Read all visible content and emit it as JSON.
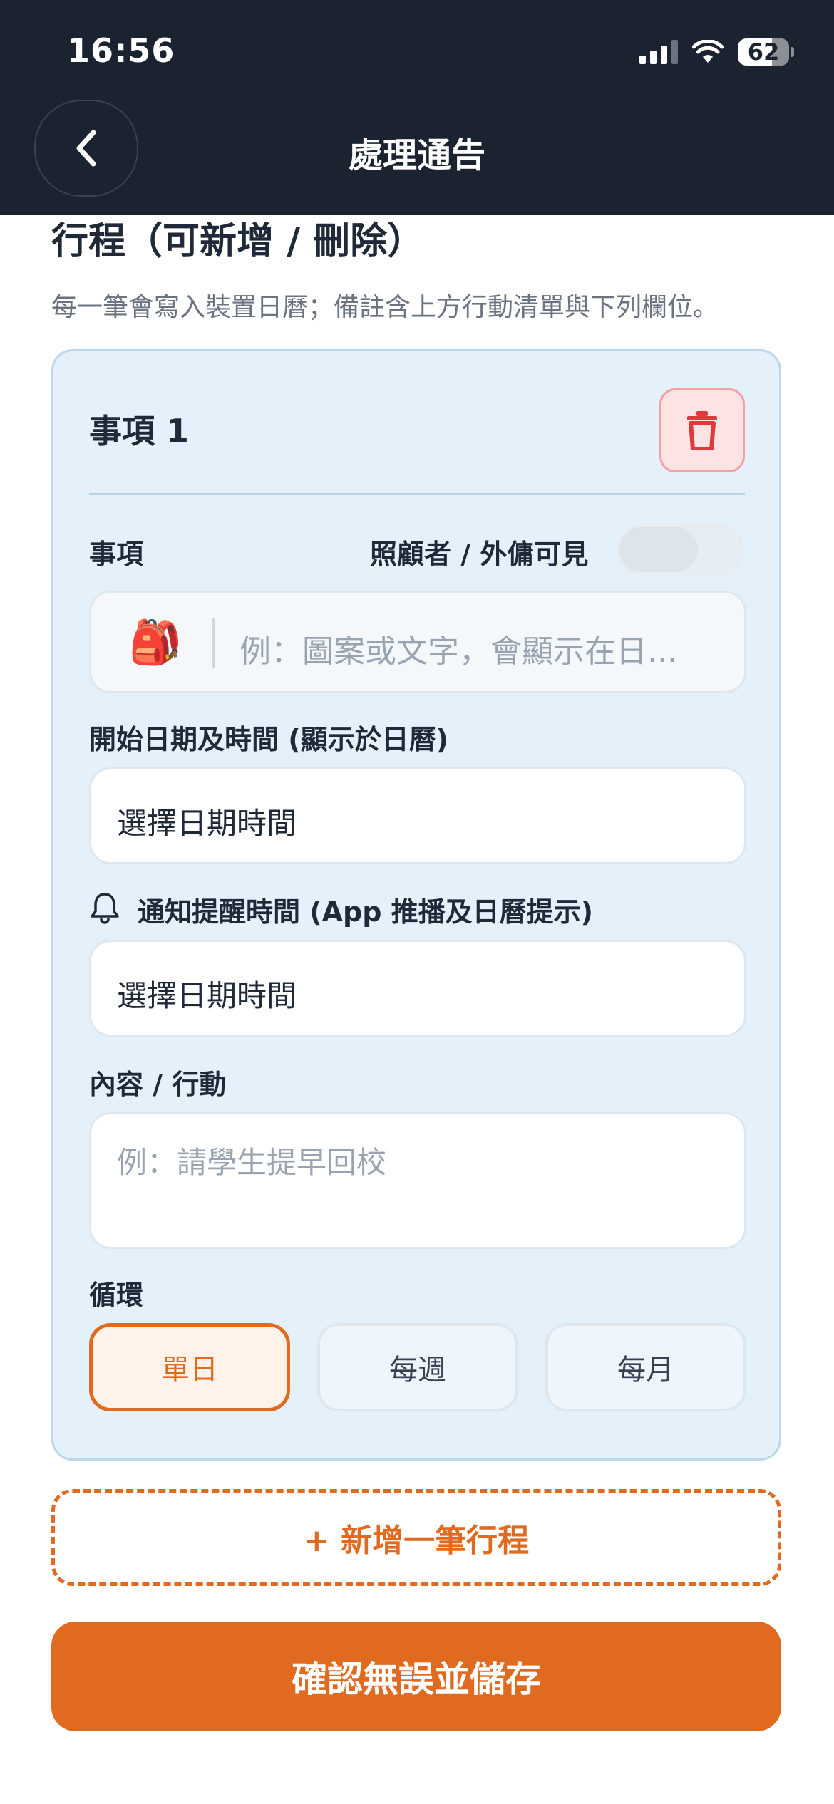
{
  "status_bar": {
    "time": "16:56",
    "battery": "62"
  },
  "header": {
    "title": "處理通告"
  },
  "section": {
    "title": "行程（可新增 / 刪除）",
    "subtitle": "每一筆會寫入裝置日曆；備註含上方行動清單與下列欄位。"
  },
  "item": {
    "title": "事項 1",
    "event_label": "事項",
    "visibility_label": "照顧者 / 外傭可見",
    "visibility_on": false,
    "emoji": "🎒",
    "event_placeholder": "例：圖案或文字，會顯示在日...",
    "start_label": "開始日期及時間 (顯示於日曆)",
    "start_value": "選擇日期時間",
    "reminder_label": "通知提醒時間 (App 推播及日曆提示)",
    "reminder_value": "選擇日期時間",
    "content_label": "內容 / 行動",
    "content_placeholder": "例：請學生提早回校",
    "repeat_label": "循環",
    "repeat_options": [
      "單日",
      "每週",
      "每月"
    ],
    "repeat_selected": "單日"
  },
  "add_label": "+ 新增一筆行程",
  "save_label": "確認無誤並儲存",
  "colors": {
    "accent": "#e06a1f",
    "header_bg": "#1b2230",
    "card_bg": "#e4f1fb",
    "danger": "#e03a3a"
  }
}
